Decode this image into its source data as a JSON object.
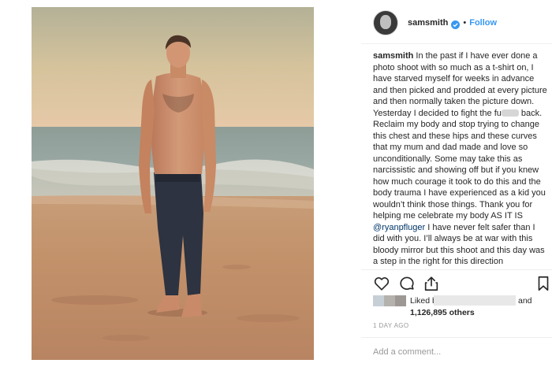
{
  "post": {
    "username": "samsmith",
    "follow_label": "Follow",
    "separator": "•",
    "caption": {
      "username": "samsmith",
      "text_before_blur": "In the past if I have ever done a photo shoot with so much as a t-shirt on, I have starved myself for weeks in advance and then picked and prodded at every picture and then normally taken the picture down. Yesterday I decided to fight the fu",
      "text_after_blur": " back. Reclaim my body and stop trying to change this chest and these hips and these curves that my mum and dad made and love so unconditionally. Some may take this as narcissistic and showing off but if you knew how much courage it took to do this and the body trauma I have experienced as a kid you wouldn’t think those things. Thank you for helping me celebrate my body AS IT IS ",
      "mention": "@ryanpfluger",
      "text_after_mention": " I have never felt safer than I did with you. I’ll always be at war with this bloody mirror but this shoot and this day was a step in the right for this direction"
    },
    "likes": {
      "liked_by": "Liked by",
      "and": "and",
      "count": "1,126,895 others"
    },
    "time": "1 DAY AGO",
    "comment_placeholder": "Add a comment..."
  },
  "icons": {
    "verified": "verified-badge-icon",
    "like": "heart-icon",
    "comment": "comment-bubble-icon",
    "share": "share-icon",
    "save": "bookmark-icon"
  },
  "colors": {
    "link": "#3897f0",
    "verified": "#3897f0",
    "text": "#262626",
    "muted": "#999999"
  }
}
